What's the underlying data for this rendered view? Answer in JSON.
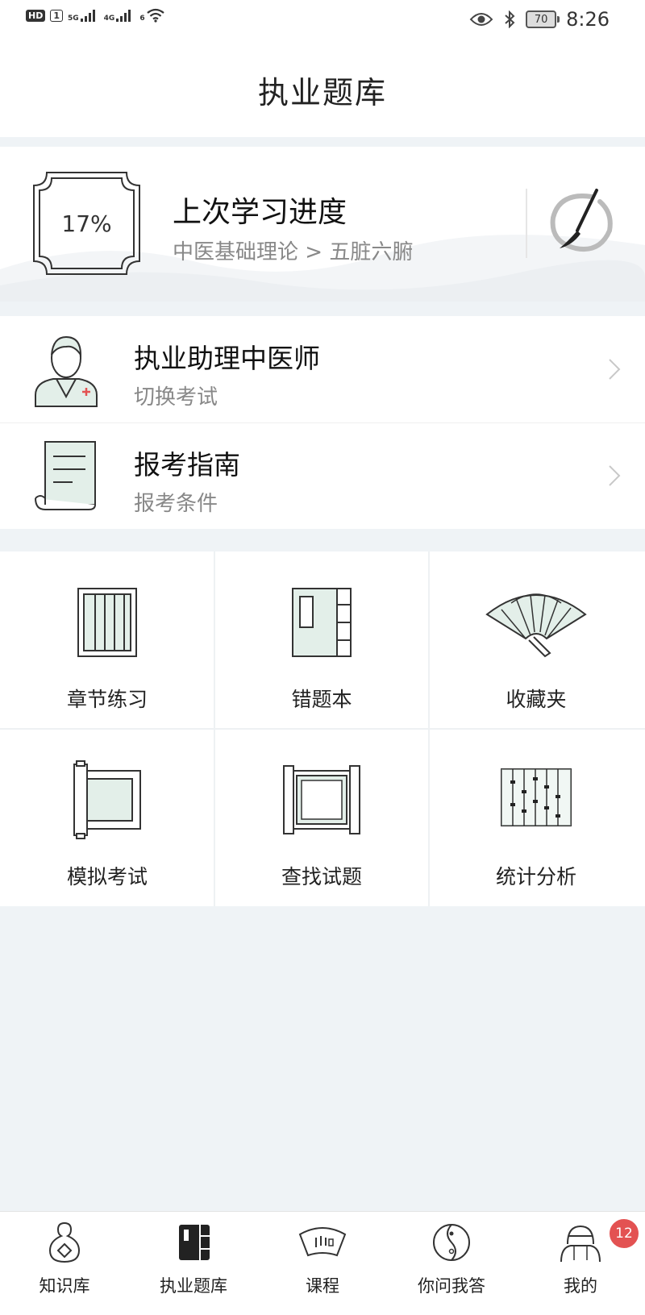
{
  "status_bar": {
    "hd": "HD",
    "sim": "1",
    "net1": "5G",
    "net2": "4G",
    "wifi": "6",
    "battery": "70",
    "time": "8:26"
  },
  "header": {
    "title": "执业题库"
  },
  "progress": {
    "percent": "17%",
    "title": "上次学习进度",
    "path": "中医基础理论 > 五脏六腑"
  },
  "list": [
    {
      "title": "执业助理中医师",
      "subtitle": "切换考试",
      "icon": "doctor-icon"
    },
    {
      "title": "报考指南",
      "subtitle": "报考条件",
      "icon": "scroll-icon"
    }
  ],
  "grid": [
    {
      "label": "章节练习",
      "icon": "chapter-practice-icon"
    },
    {
      "label": "错题本",
      "icon": "wrong-notebook-icon"
    },
    {
      "label": "收藏夹",
      "icon": "folding-fan-icon"
    },
    {
      "label": "模拟考试",
      "icon": "mock-exam-scroll-icon"
    },
    {
      "label": "查找试题",
      "icon": "search-scroll-icon"
    },
    {
      "label": "统计分析",
      "icon": "abacus-icon"
    }
  ],
  "tabs": [
    {
      "label": "知识库",
      "icon": "gourd-icon",
      "active": false
    },
    {
      "label": "执业题库",
      "icon": "book-icon",
      "active": true
    },
    {
      "label": "课程",
      "icon": "fan-icon",
      "active": false
    },
    {
      "label": "你问我答",
      "icon": "yin-yang-icon",
      "active": false
    },
    {
      "label": "我的",
      "icon": "avatar-icon",
      "active": false
    }
  ],
  "profile_badge": "12",
  "colors": {
    "accent": "#e35252",
    "icon_fill": "#e3efe9",
    "background": "#eff3f6"
  }
}
